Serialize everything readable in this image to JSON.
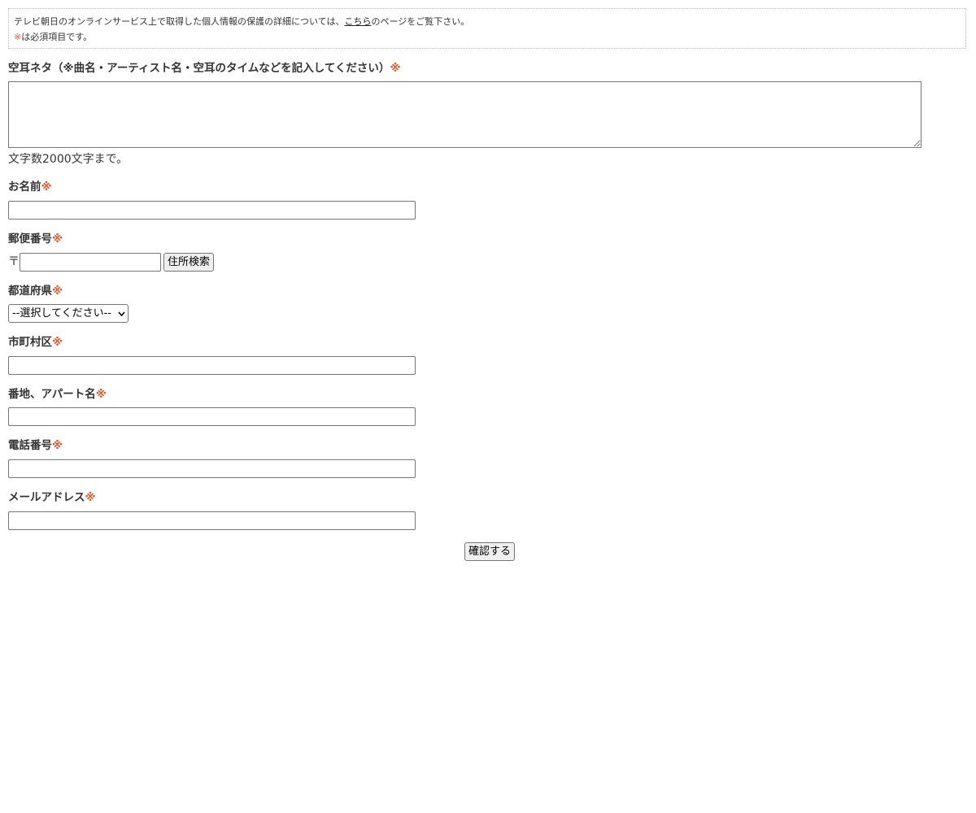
{
  "notice": {
    "line1_prefix": "テレビ朝日のオンラインサービス上で取得した個人情報の保護の詳細については、",
    "link_text": "こちら",
    "line1_suffix": "のページをご覧下さい。",
    "required_mark": "※",
    "line2_suffix": "は必須項目です。"
  },
  "required_mark": "※",
  "form": {
    "neta": {
      "label": "空耳ネタ（※曲名・アーティスト名・空耳のタイムなどを記入してください）",
      "value": "",
      "help": "文字数2000文字まで。"
    },
    "name": {
      "label": "お名前",
      "value": ""
    },
    "zip": {
      "label": "郵便番号",
      "mark": "〒",
      "value": "",
      "search_button": "住所検索"
    },
    "prefecture": {
      "label": "都道府県",
      "selected": "--選択してください--"
    },
    "city": {
      "label": "市町村区",
      "value": ""
    },
    "address": {
      "label": "番地、アパート名",
      "value": ""
    },
    "phone": {
      "label": "電話番号",
      "value": ""
    },
    "email": {
      "label": "メールアドレス",
      "value": ""
    },
    "confirm_button": "確認する"
  },
  "colors": {
    "required": "#e05a2b",
    "text": "#333333",
    "border": "#767676"
  },
  "icons": {
    "select_arrow": "chevron-down-icon"
  }
}
